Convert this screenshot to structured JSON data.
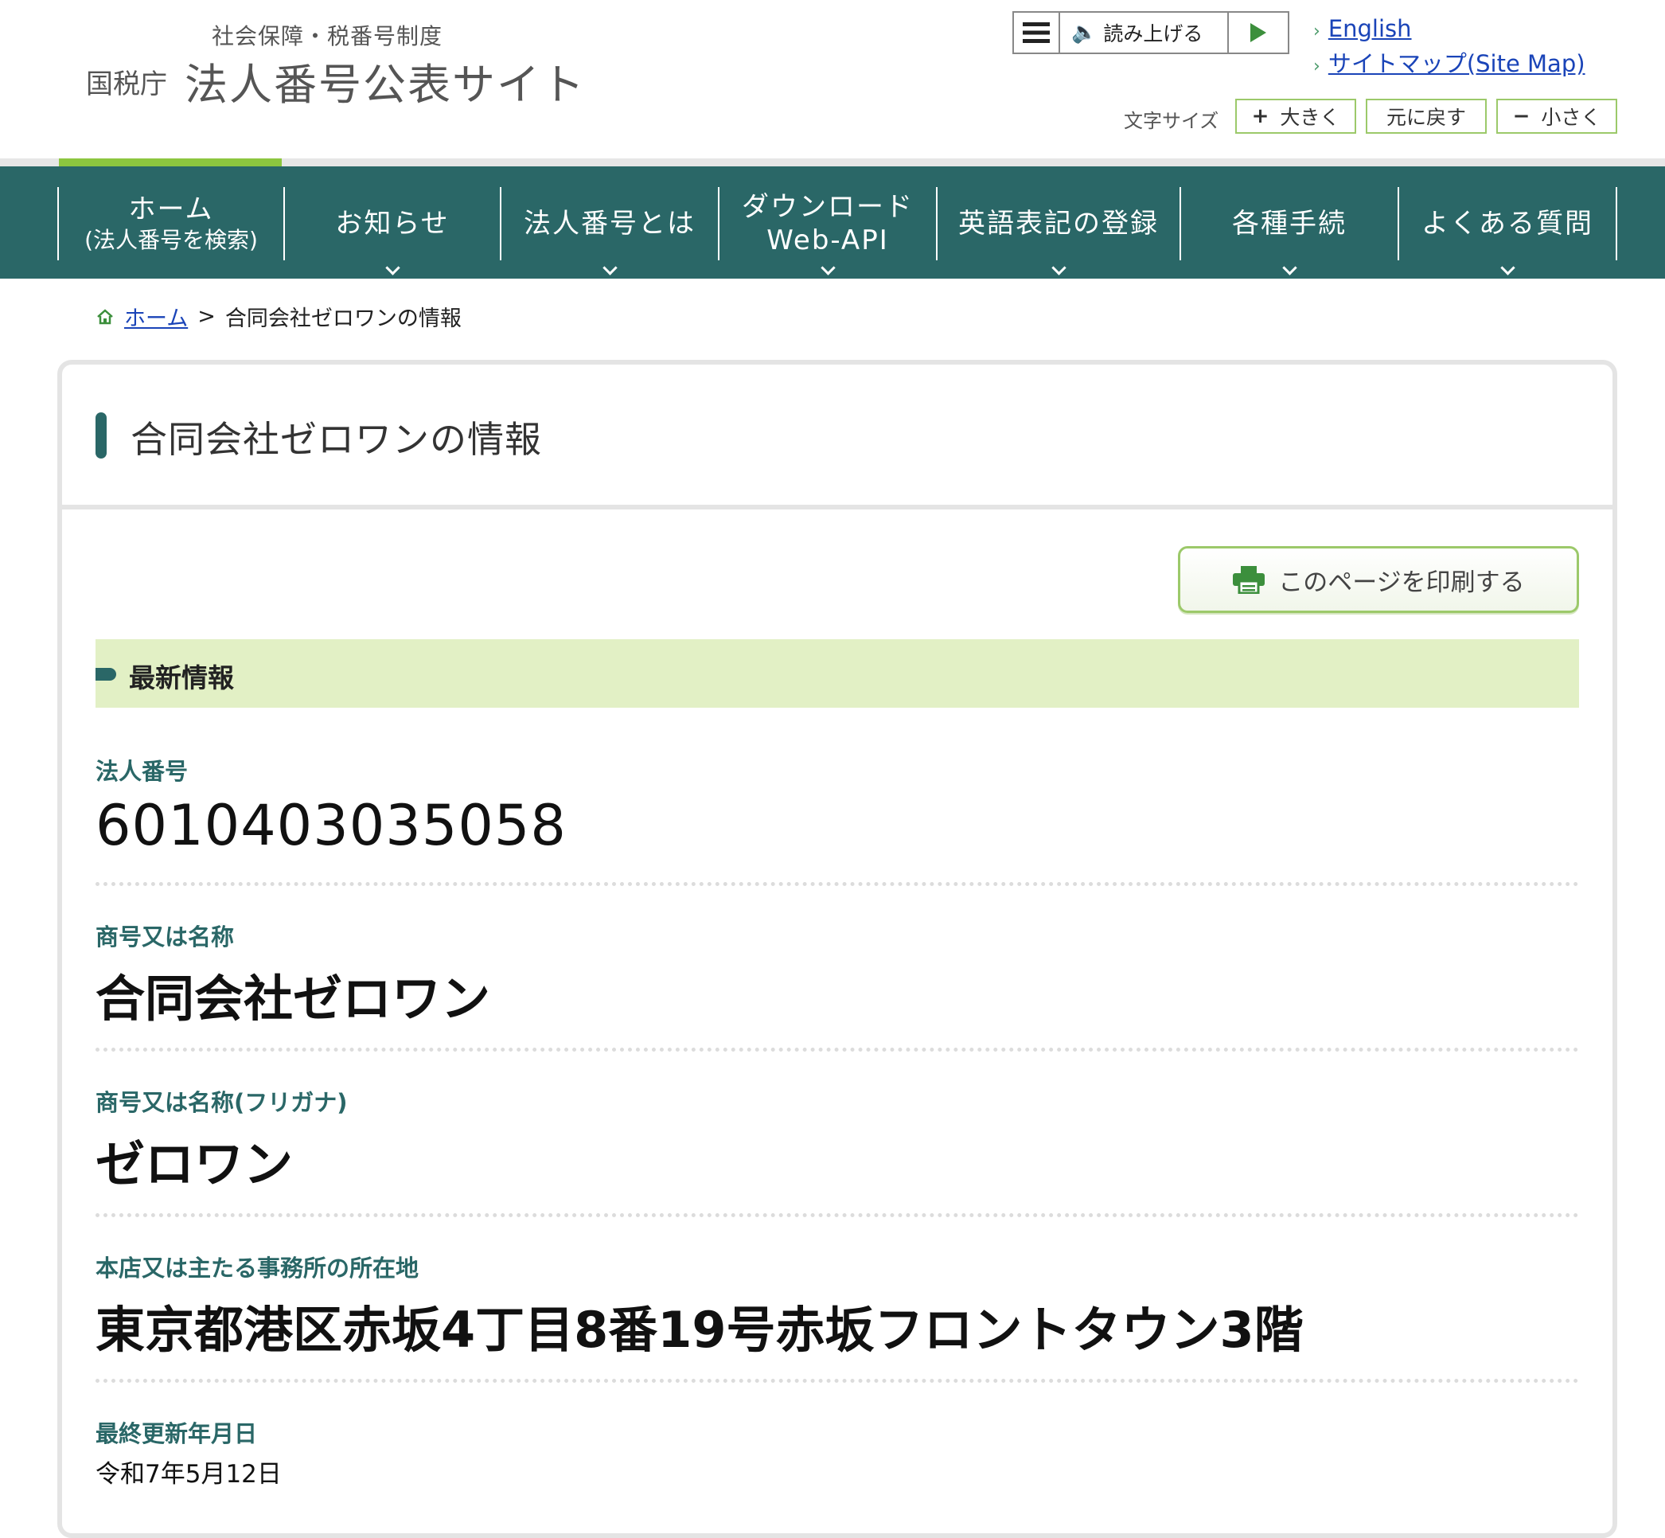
{
  "header": {
    "logo_sub": "社会保障・税番号制度",
    "logo_agency": "国税庁",
    "logo_main": "法人番号公表サイト",
    "reader_label": "読み上げる",
    "links": [
      "English",
      "サイトマップ(Site Map)"
    ],
    "fontsize_label": "文字サイズ",
    "fontsize_buttons": [
      {
        "symbol": "+",
        "label": "大きく"
      },
      {
        "symbol": "",
        "label": "元に戻す"
      },
      {
        "symbol": "−",
        "label": "小さく"
      }
    ]
  },
  "nav": {
    "items": [
      {
        "line1": "ホーム",
        "line2": "(法人番号を検索)"
      },
      {
        "line1": "お知らせ",
        "line2": ""
      },
      {
        "line1": "法人番号とは",
        "line2": ""
      },
      {
        "line1": "ダウンロード",
        "line2": "Web-API"
      },
      {
        "line1": "英語表記の登録",
        "line2": ""
      },
      {
        "line1": "各種手続",
        "line2": ""
      },
      {
        "line1": "よくある質問",
        "line2": ""
      }
    ]
  },
  "breadcrumb": {
    "home": "ホーム",
    "separator": ">",
    "current": "合同会社ゼロワンの情報"
  },
  "panel": {
    "title": "合同会社ゼロワンの情報",
    "print_label": "このページを印刷する",
    "section_label": "最新情報",
    "fields": [
      {
        "label": "法人番号",
        "value": "6010403035058"
      },
      {
        "label": "商号又は名称",
        "value": "合同会社ゼロワン"
      },
      {
        "label": "商号又は名称(フリガナ)",
        "value": "ゼロワン"
      },
      {
        "label": "本店又は主たる事務所の所在地",
        "value": "東京都港区赤坂4丁目8番19号赤坂フロントタウン3階"
      },
      {
        "label": "最終更新年月日",
        "value": "令和7年5月12日"
      }
    ]
  },
  "colors": {
    "nav_bg": "#2a6767",
    "accent_green": "#8cc63f",
    "section_band": "#e2f0c5",
    "link": "#1a44b8"
  }
}
